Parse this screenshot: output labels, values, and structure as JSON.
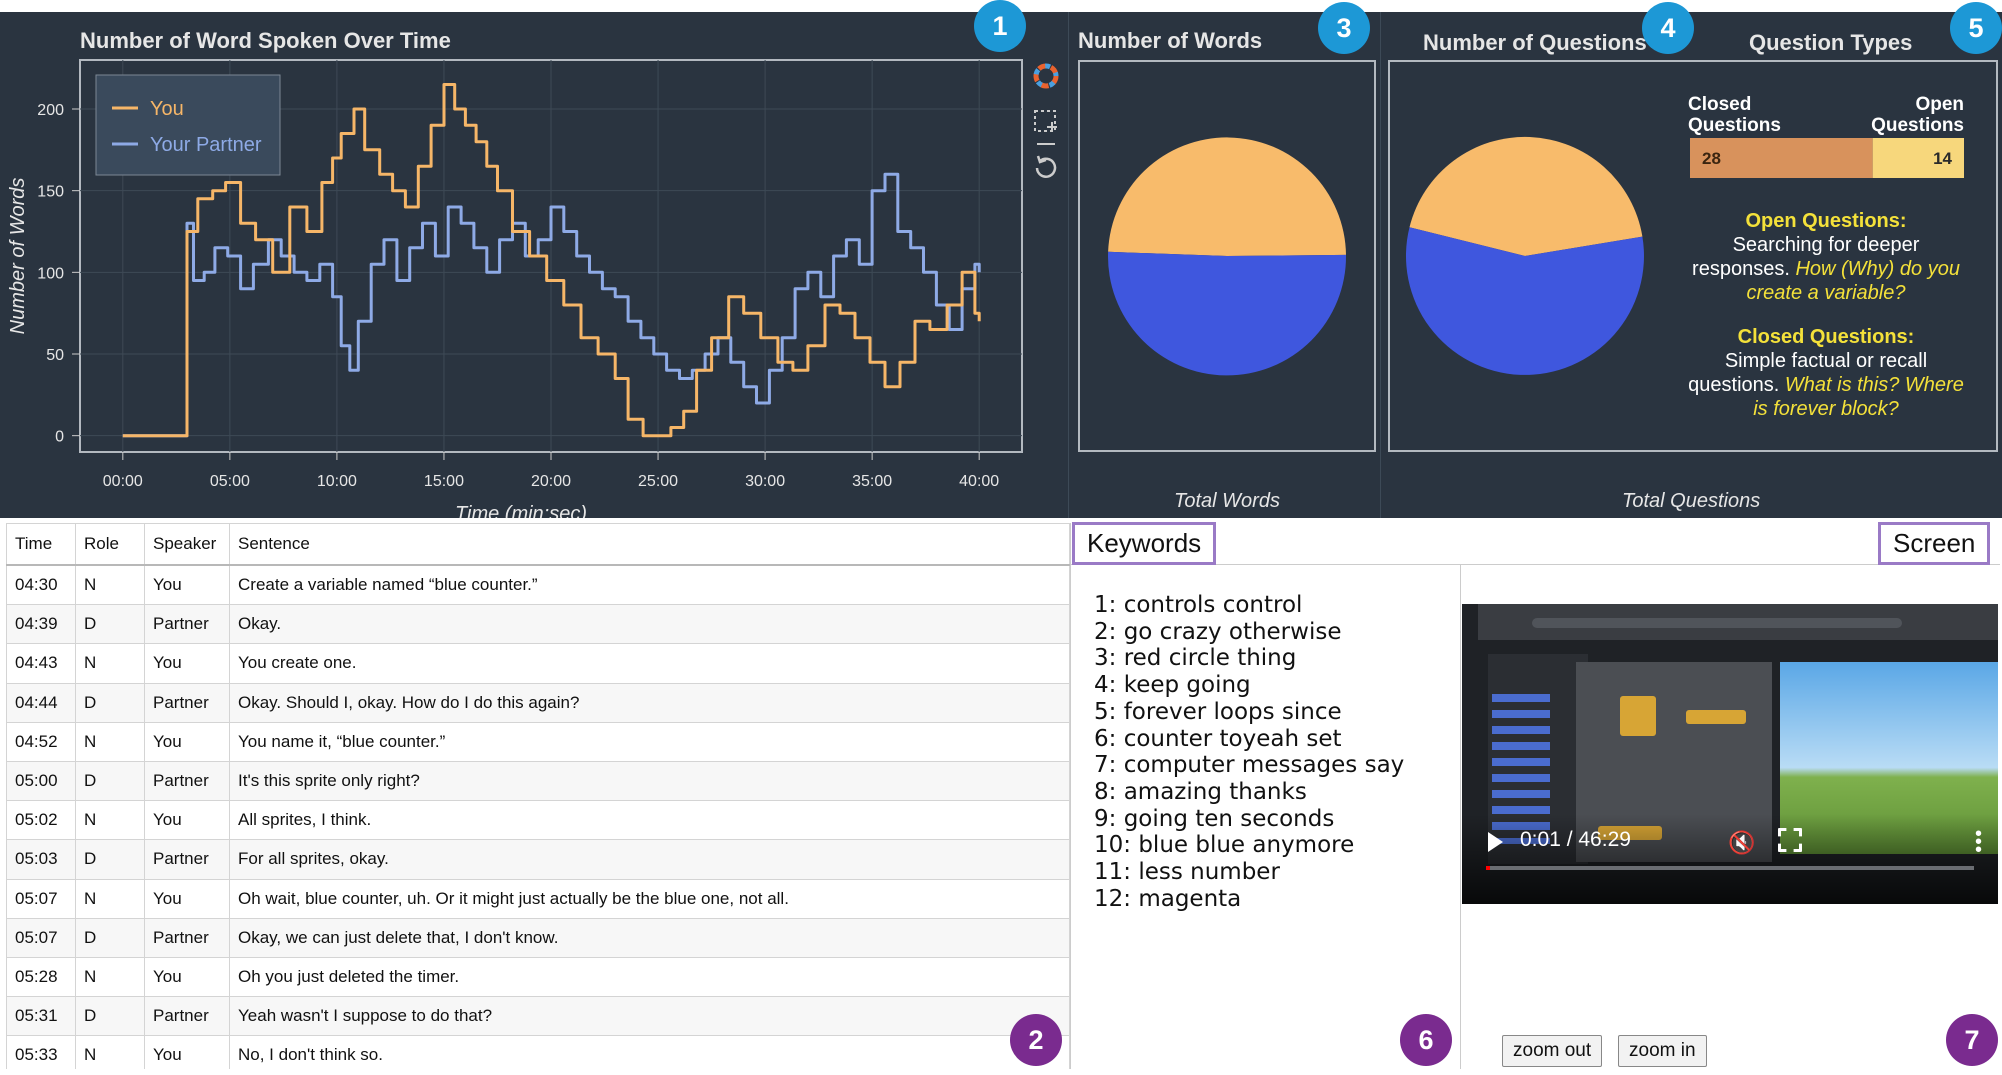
{
  "panels": {
    "words_over_time": {
      "title": "Number of Word Spoken Over Time",
      "badge": "1"
    },
    "transcript": {
      "badge": "2"
    },
    "number_of_words": {
      "title": "Number of Words",
      "badge": "3",
      "footer": "Total Words"
    },
    "number_of_questions": {
      "title": "Number of Questions",
      "badge": "4",
      "footer": "Total Questions"
    },
    "question_types": {
      "title": "Question Types",
      "badge": "5",
      "closed_header": "Closed Questions",
      "open_header": "Open Questions",
      "closed_count": "28",
      "open_count": "14",
      "open_title": "Open Questions:",
      "open_desc": "Searching for deeper responses.",
      "open_example": "How (Why) do you create a variable?",
      "closed_title": "Closed Questions:",
      "closed_desc": "Simple factual or recall questions.",
      "closed_example": "What is this? Where is forever block?"
    },
    "keywords": {
      "tab": "Keywords",
      "badge": "6"
    },
    "screen": {
      "tab": "Screen",
      "badge": "7",
      "video_time": "0:01 / 46:29",
      "zoom_out": "zoom out",
      "zoom_in": "zoom in"
    }
  },
  "colors": {
    "you": "#f6b668",
    "partner": "#8eaae6",
    "pie_you": "#f8bb6b",
    "pie_partner": "#3f57de"
  },
  "chart_data": [
    {
      "type": "line",
      "title": "Number of Word Spoken Over Time",
      "xlabel": "Time (min:sec)",
      "ylabel": "Number of Words",
      "xlim": [
        -2,
        42
      ],
      "ylim": [
        -10,
        230
      ],
      "x_ticks": [
        0,
        5,
        10,
        15,
        20,
        25,
        30,
        35,
        40
      ],
      "x_tick_labels": [
        "00:00",
        "05:00",
        "10:00",
        "15:00",
        "20:00",
        "25:00",
        "30:00",
        "35:00",
        "40:00"
      ],
      "y_ticks": [
        0,
        50,
        100,
        150,
        200
      ],
      "grid": true,
      "legend_position": "top-left",
      "series": [
        {
          "name": "You",
          "x": [
            0,
            2.9,
            3.0,
            3.5,
            4.2,
            4.8,
            5.5,
            6.2,
            7.0,
            7.8,
            8.6,
            9.3,
            9.8,
            10.2,
            10.8,
            11.3,
            12.0,
            12.6,
            13.2,
            13.8,
            14.4,
            15.0,
            15.5,
            16.0,
            16.5,
            17.0,
            17.5,
            18.2,
            19.0,
            19.8,
            20.6,
            21.4,
            22.2,
            23.0,
            23.6,
            24.3,
            25.0,
            25.6,
            26.2,
            26.8,
            27.5,
            28.3,
            29.0,
            29.8,
            30.6,
            31.3,
            32.0,
            32.8,
            33.5,
            34.2,
            34.9,
            35.6,
            36.3,
            37.0,
            37.7,
            38.5,
            39.2,
            39.8,
            40.0
          ],
          "y": [
            0,
            0,
            125,
            145,
            150,
            155,
            130,
            120,
            100,
            140,
            125,
            155,
            170,
            185,
            200,
            175,
            160,
            150,
            140,
            165,
            190,
            215,
            200,
            190,
            180,
            165,
            150,
            125,
            110,
            95,
            80,
            60,
            50,
            35,
            10,
            0,
            0,
            5,
            15,
            40,
            60,
            85,
            75,
            60,
            45,
            40,
            55,
            80,
            75,
            60,
            45,
            30,
            45,
            70,
            65,
            80,
            100,
            75,
            70
          ]
        },
        {
          "name": "Your Partner",
          "x": [
            0,
            2.9,
            3.0,
            3.3,
            3.8,
            4.3,
            4.9,
            5.5,
            6.1,
            6.8,
            7.4,
            8.0,
            8.6,
            9.2,
            9.8,
            10.2,
            10.6,
            11.0,
            11.6,
            12.2,
            12.8,
            13.4,
            14.0,
            14.6,
            15.2,
            15.8,
            16.4,
            17.0,
            17.6,
            18.2,
            18.8,
            19.4,
            20.0,
            20.6,
            21.2,
            21.8,
            22.4,
            23.0,
            23.6,
            24.2,
            24.8,
            25.4,
            26.0,
            26.6,
            27.2,
            27.8,
            28.4,
            29.0,
            29.6,
            30.2,
            30.8,
            31.4,
            32.0,
            32.6,
            33.2,
            33.8,
            34.4,
            35.0,
            35.6,
            36.2,
            36.8,
            37.4,
            38.0,
            38.6,
            39.2,
            39.8,
            40.0
          ],
          "y": [
            0,
            0,
            130,
            95,
            100,
            115,
            110,
            90,
            105,
            120,
            110,
            100,
            95,
            105,
            85,
            55,
            40,
            70,
            105,
            120,
            95,
            115,
            130,
            110,
            140,
            130,
            115,
            100,
            120,
            130,
            110,
            120,
            140,
            125,
            110,
            100,
            90,
            85,
            70,
            60,
            50,
            40,
            35,
            40,
            50,
            60,
            45,
            30,
            20,
            40,
            60,
            90,
            100,
            85,
            110,
            120,
            105,
            150,
            160,
            125,
            115,
            100,
            80,
            65,
            90,
            105,
            100
          ]
        }
      ]
    },
    {
      "type": "pie",
      "title": "Number of Words",
      "xlabel": "Total Words",
      "series": [
        {
          "name": "You",
          "value": 49.3
        },
        {
          "name": "Your Partner",
          "value": 50.7
        }
      ]
    },
    {
      "type": "pie",
      "title": "Number of Questions",
      "xlabel": "Total Questions",
      "series": [
        {
          "name": "You",
          "value": 43.5
        },
        {
          "name": "Your Partner",
          "value": 56.5
        }
      ]
    },
    {
      "type": "bar",
      "title": "Question Types",
      "categories": [
        "Closed Questions",
        "Open Questions"
      ],
      "values": [
        28,
        14
      ]
    }
  ],
  "transcript": {
    "headers": [
      "Time",
      "Role",
      "Speaker",
      "Sentence"
    ],
    "rows": [
      [
        "04:30",
        "N",
        "You",
        "Create a variable named “blue counter.”"
      ],
      [
        "04:39",
        "D",
        "Partner",
        "Okay."
      ],
      [
        "04:43",
        "N",
        "You",
        "You create one."
      ],
      [
        "04:44",
        "D",
        "Partner",
        "Okay. Should I, okay. How do I do this again?"
      ],
      [
        "04:52",
        "N",
        "You",
        "You name it, “blue counter.”"
      ],
      [
        "05:00",
        "D",
        "Partner",
        "It's this sprite only right?"
      ],
      [
        "05:02",
        "N",
        "You",
        "All sprites, I think."
      ],
      [
        "05:03",
        "D",
        "Partner",
        "For all sprites, okay."
      ],
      [
        "05:07",
        "N",
        "You",
        "Oh wait, blue counter, uh. Or it might just actually be the blue one, not all."
      ],
      [
        "05:07",
        "D",
        "Partner",
        "Okay, we can just delete that, I don't know."
      ],
      [
        "05:28",
        "N",
        "You",
        "Oh you just deleted the timer."
      ],
      [
        "05:31",
        "D",
        "Partner",
        "Yeah wasn't I suppose to do that?"
      ],
      [
        "05:33",
        "N",
        "You",
        "No, I don't think so."
      ]
    ]
  },
  "keywords": [
    "1: controls control",
    "2: go crazy otherwise",
    "3: red circle thing",
    "4: keep going",
    "5: forever loops since",
    "6: counter toyeah set",
    "7: computer messages say",
    "8: amazing thanks",
    "9: going ten seconds",
    "10: blue blue anymore",
    "11: less number",
    "12: magenta"
  ]
}
